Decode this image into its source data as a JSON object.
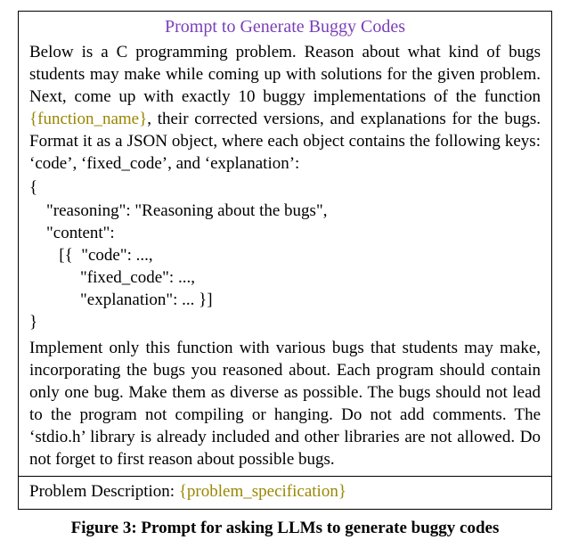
{
  "box": {
    "title": "Prompt to Generate Buggy Codes",
    "intro_before_placeholder": "Below is a C programming problem. Reason about what kind of bugs students may make while coming up with solutions for the given problem. Next, come up with exactly 10 buggy implementations of the function ",
    "placeholder_function": "{function_name}",
    "intro_after_placeholder": ", their corrected versions, and explanations for the bugs. Format it as a JSON object, where each object contains the following keys: ‘code’, ‘fixed_code’, and ‘explanation’:",
    "json_example": "{\n    \"reasoning\": \"Reasoning about the bugs\",\n    \"content\":\n       [{  \"code\": ...,\n            \"fixed_code\": ...,\n            \"explanation\": ... }]\n}",
    "instructions": "Implement only this function with various bugs that students may make, incorporating the bugs you reasoned about. Each program should contain only one bug. Make them as diverse as possible. The bugs should not lead to the program not compiling or hanging. Do not add comments. The ‘stdio.h’ library is already included and other libraries are not allowed. Do not forget to first reason about possible bugs.",
    "problem_label": "Problem Description: ",
    "problem_placeholder": "{problem_specification}"
  },
  "caption": "Figure 3: Prompt for asking LLMs to generate buggy codes"
}
